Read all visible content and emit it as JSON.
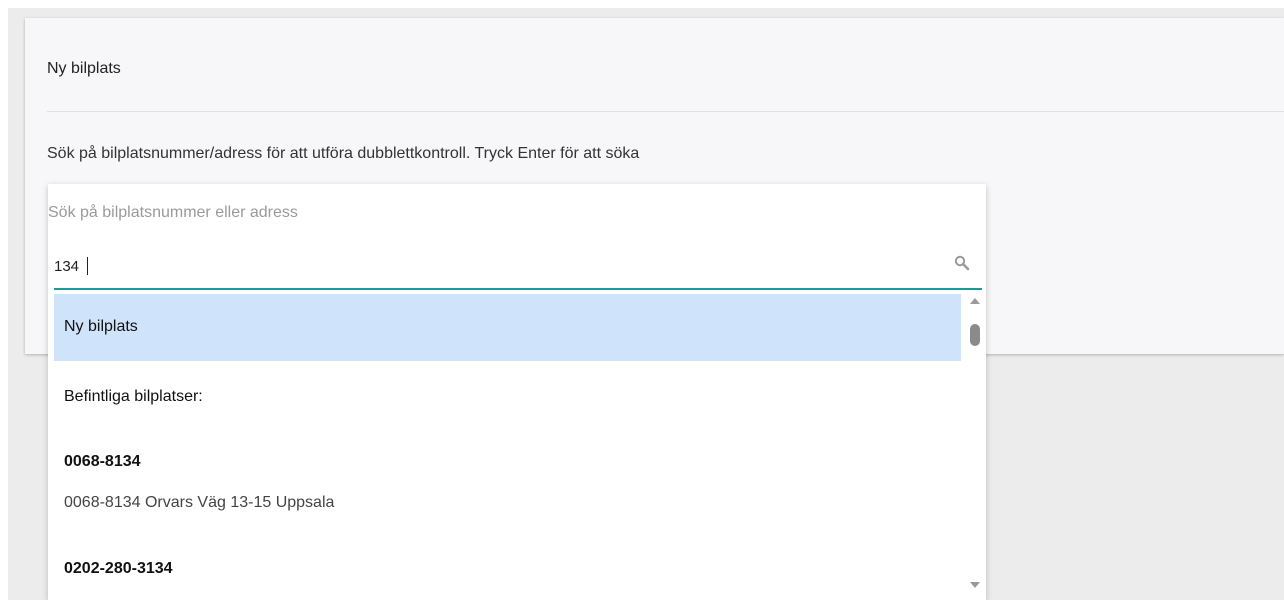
{
  "card": {
    "title": "Ny bilplats",
    "instruction": "Sök på bilplatsnummer/adress för att utföra dubblettkontroll. Tryck Enter för att söka"
  },
  "search": {
    "label": "Sök på bilplatsnummer eller adress",
    "value": "134",
    "icon": "search-icon"
  },
  "dropdown": {
    "new_option": "Ny bilplats",
    "existing_header": "Befintliga bilplatser:",
    "results": [
      {
        "id": "0068-8134",
        "address": "0068-8134 Orvars Väg 13-15 Uppsala"
      },
      {
        "id": "0202-280-3134",
        "address": ""
      }
    ]
  },
  "colors": {
    "accent_underline": "#1a9a9a",
    "selected_option_bg": "#cfe3fb"
  }
}
